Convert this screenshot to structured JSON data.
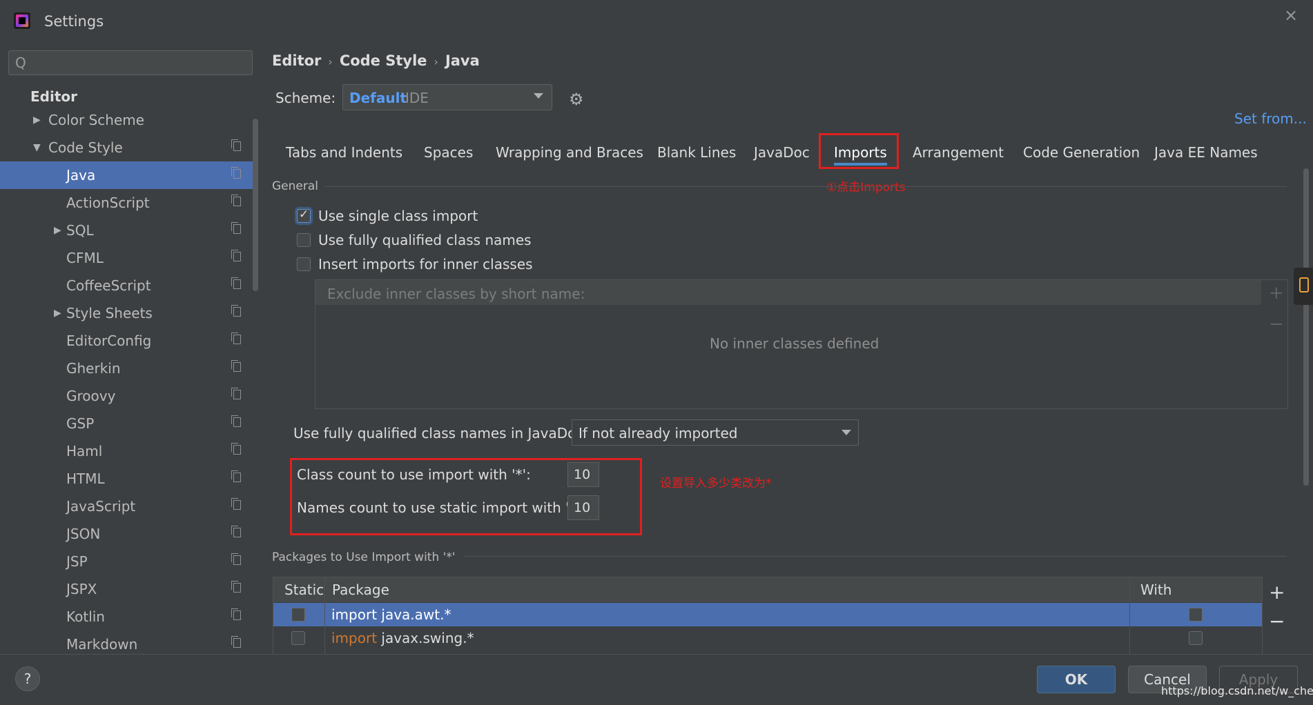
{
  "window": {
    "title": "Settings",
    "close": "×"
  },
  "sidebar": {
    "search_placeholder": "",
    "search_icon": "Q",
    "section": "Editor",
    "items": [
      {
        "label": "Color Scheme",
        "arrow": "▶"
      },
      {
        "label": "Code Style",
        "arrow": "▼"
      },
      {
        "label": "Java",
        "arrow": ""
      },
      {
        "label": "ActionScript",
        "arrow": ""
      },
      {
        "label": "SQL",
        "arrow": "▶"
      },
      {
        "label": "CFML",
        "arrow": ""
      },
      {
        "label": "CoffeeScript",
        "arrow": ""
      },
      {
        "label": "Style Sheets",
        "arrow": "▶"
      },
      {
        "label": "EditorConfig",
        "arrow": ""
      },
      {
        "label": "Gherkin",
        "arrow": ""
      },
      {
        "label": "Groovy",
        "arrow": ""
      },
      {
        "label": "GSP",
        "arrow": ""
      },
      {
        "label": "Haml",
        "arrow": ""
      },
      {
        "label": "HTML",
        "arrow": ""
      },
      {
        "label": "JavaScript",
        "arrow": ""
      },
      {
        "label": "JSON",
        "arrow": ""
      },
      {
        "label": "JSP",
        "arrow": ""
      },
      {
        "label": "JSPX",
        "arrow": ""
      },
      {
        "label": "Kotlin",
        "arrow": ""
      },
      {
        "label": "Markdown",
        "arrow": ""
      }
    ]
  },
  "breadcrumb": {
    "a": "Editor",
    "b": "Code Style",
    "c": "Java",
    "sep": "›"
  },
  "scheme": {
    "label": "Scheme:",
    "name": "Default",
    "kind": "IDE"
  },
  "set_from": "Set from...",
  "tabs": [
    "Tabs and Indents",
    "Spaces",
    "Wrapping and Braces",
    "Blank Lines",
    "JavaDoc",
    "Imports",
    "Arrangement",
    "Code Generation",
    "Java EE Names"
  ],
  "annotations": {
    "imports": "①点击Imports",
    "count": "设置导入多少类改为*"
  },
  "general": {
    "title": "General",
    "options": [
      {
        "label": "Use single class import",
        "checked": true
      },
      {
        "label": "Use fully qualified class names",
        "checked": false
      },
      {
        "label": "Insert imports for inner classes",
        "checked": false
      }
    ],
    "inner_header": "Exclude inner classes by short name:",
    "inner_empty": "No inner classes defined",
    "add": "+",
    "remove": "−",
    "javadoc_label": "Use fully qualified class names in JavaDoc:",
    "javadoc_value": "If not already imported",
    "class_count_label": "Class count to use import with '*':",
    "class_count_value": "10",
    "names_count_label": "Names count to use static import with '*':",
    "names_count_value": "10"
  },
  "packages": {
    "title": "Packages to Use Import with '*'",
    "headers": {
      "static": "Static",
      "package": "Package",
      "subpackages": "With Subpackages"
    },
    "rows": [
      {
        "keyword": "import",
        "name": " java.awt.*",
        "static": false,
        "subpackages": false,
        "selected": true
      },
      {
        "keyword": "import",
        "name": " javax.swing.*",
        "static": false,
        "subpackages": false,
        "selected": false
      }
    ],
    "add": "+",
    "remove": "−"
  },
  "buttons": {
    "help": "?",
    "ok": "OK",
    "cancel": "Cancel",
    "apply": "Apply"
  },
  "watermark": "https://blog.csdn.net/w_cheng"
}
